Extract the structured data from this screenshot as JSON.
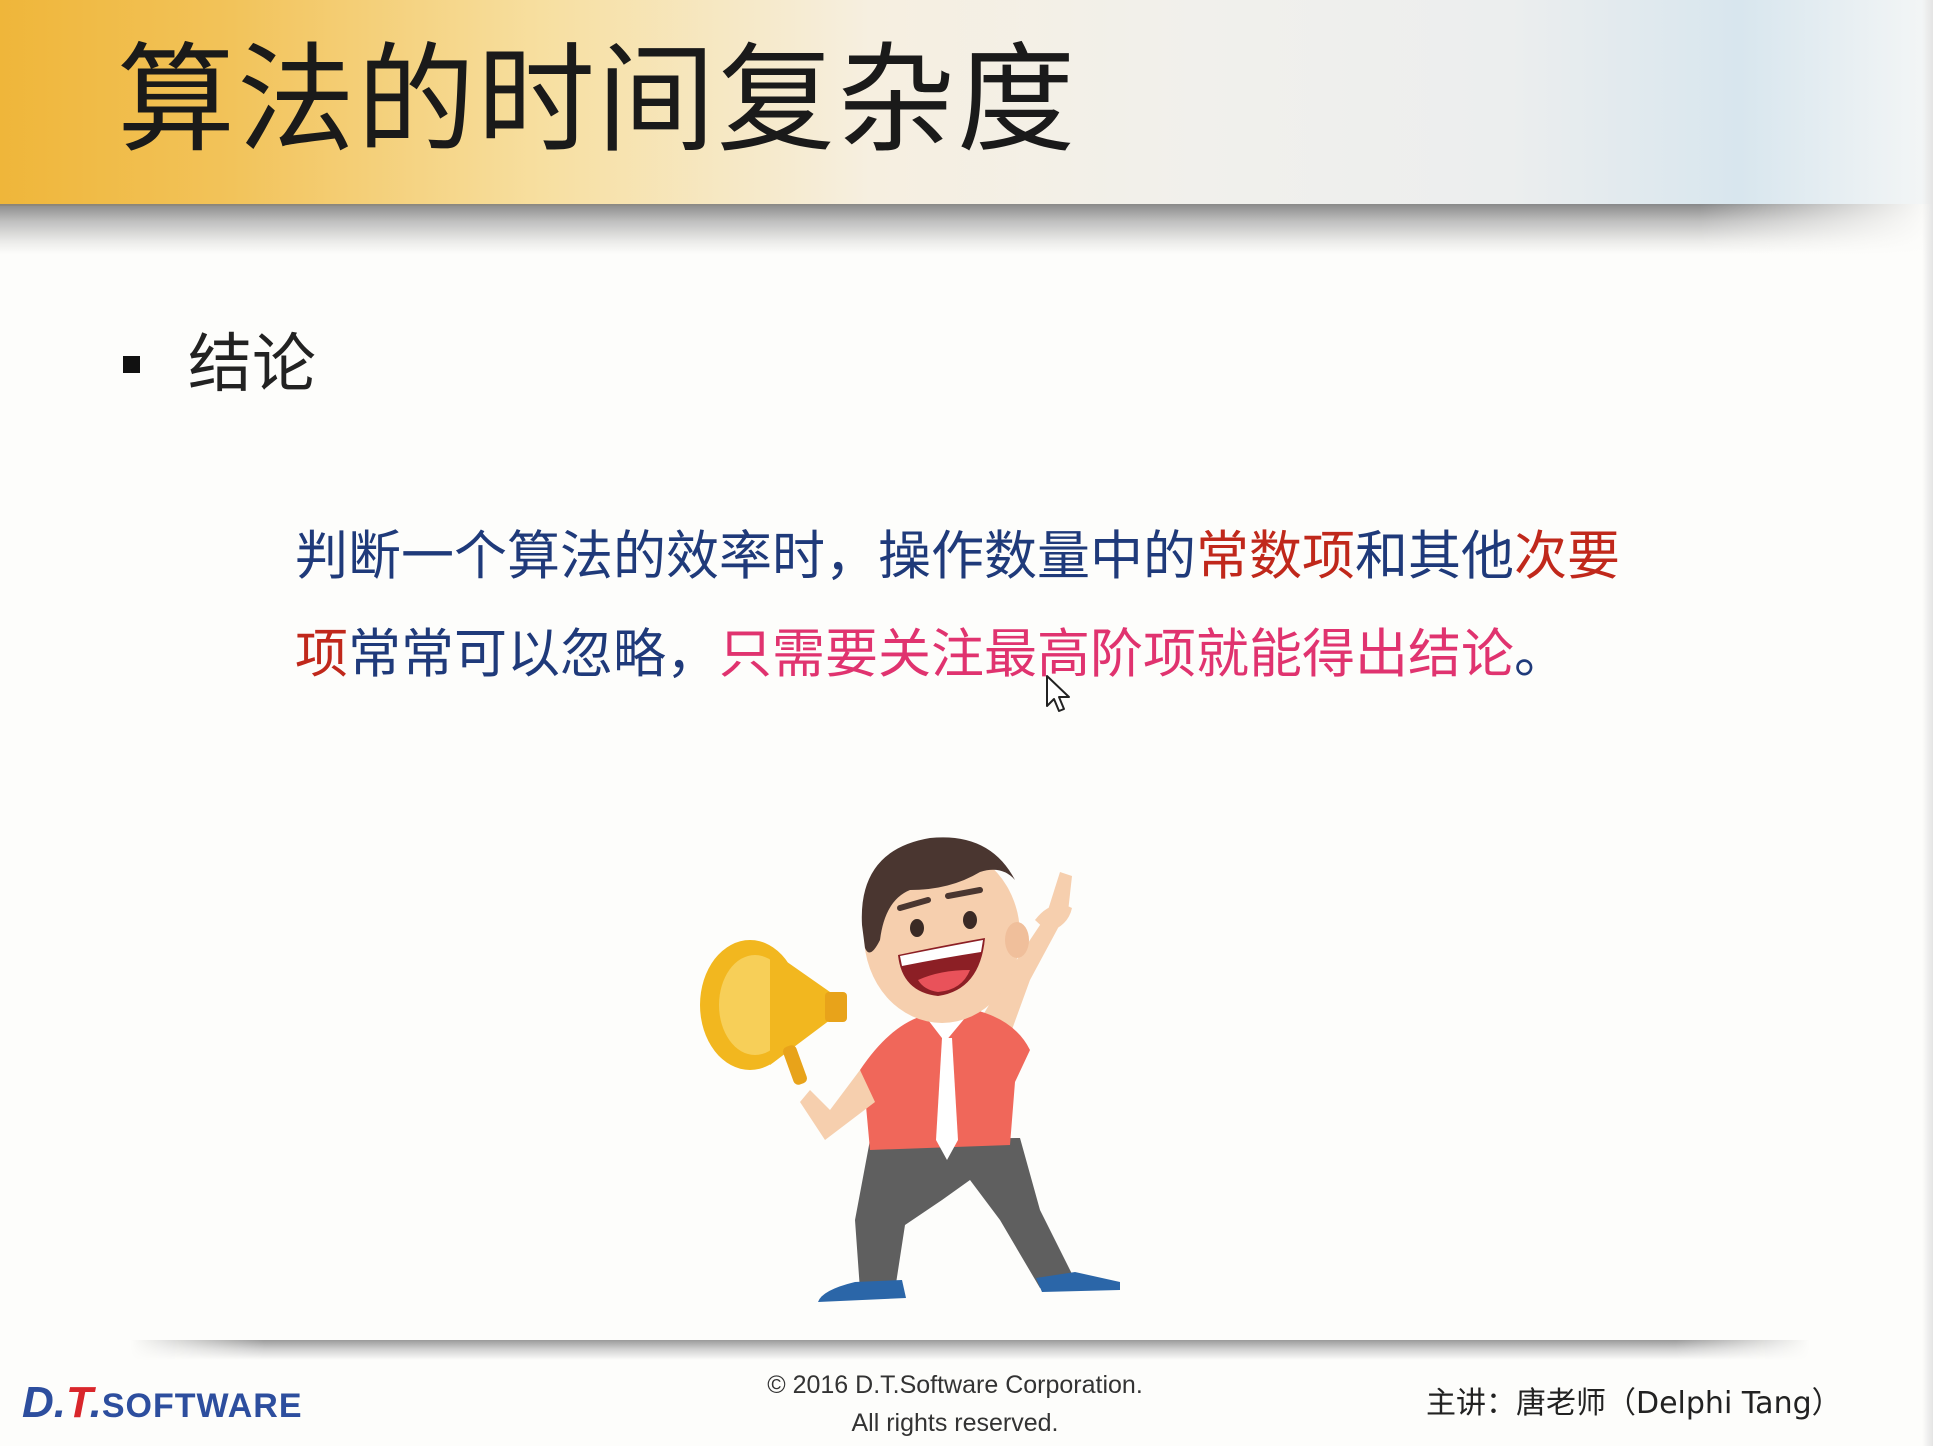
{
  "slide": {
    "title": "算法的时间复杂度",
    "bullet": "结论",
    "conclusion": {
      "line1": [
        {
          "text": "判断一个算法的效率时，操作数量中的",
          "color": "navy"
        },
        {
          "text": "常数项",
          "color": "red"
        },
        {
          "text": "和其他",
          "color": "navy"
        },
        {
          "text": "次要",
          "color": "red"
        }
      ],
      "line2": [
        {
          "text": "项",
          "color": "red"
        },
        {
          "text": "常常可以忽略，",
          "color": "navy"
        },
        {
          "text": "只需要关注最高阶项就能得出结论",
          "color": "pink"
        },
        {
          "text": "。",
          "color": "navy"
        }
      ]
    },
    "illustration": "cartoon-man-with-megaphone"
  },
  "footer": {
    "logo_dt": "D.",
    "logo_t": "T",
    "logo_dot": ".",
    "logo_software": "SOFTWARE",
    "copyright_line1": "© 2016 D.T.Software Corporation.",
    "copyright_line2": "All rights reserved.",
    "presenter": "主讲：唐老师（Delphi Tang）"
  },
  "colors": {
    "navy": "#1f3a7a",
    "red": "#c0281b",
    "pink": "#e0336f",
    "header_accent": "#efb63a"
  }
}
